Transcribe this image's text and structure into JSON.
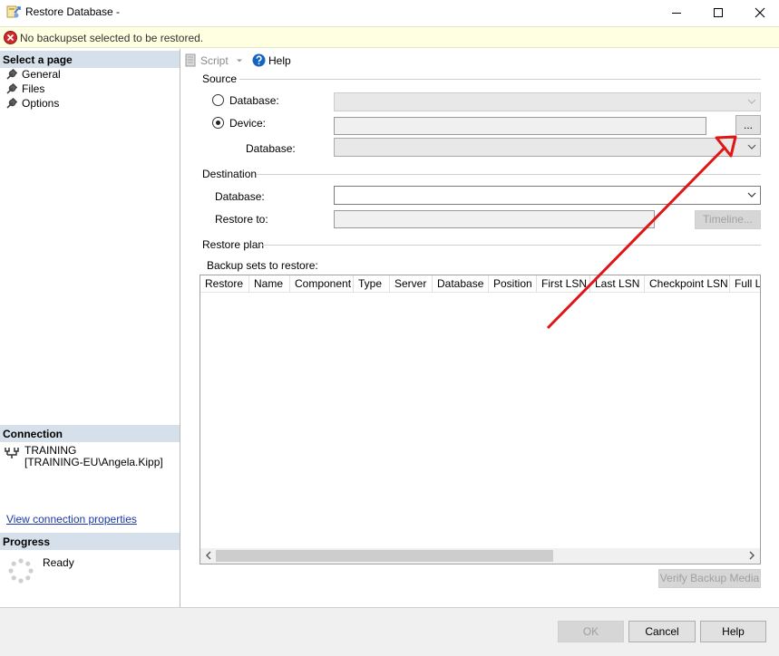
{
  "window": {
    "title": "Restore Database -"
  },
  "error_bar": {
    "message": "No backupset selected to be restored."
  },
  "left_panel": {
    "select_page_header": "Select a page",
    "pages": [
      "General",
      "Files",
      "Options"
    ],
    "connection_header": "Connection",
    "connection_server": "TRAINING",
    "connection_user": "[TRAINING-EU\\Angela.Kipp]",
    "connection_link": "View connection properties",
    "progress_header": "Progress",
    "progress_status": "Ready"
  },
  "toolbar": {
    "script_label": "Script",
    "help_label": "Help"
  },
  "source": {
    "section_label": "Source",
    "database_radio_label": "Database:",
    "device_radio_label": "Device:",
    "selected": "device",
    "device_database_label": "Database:",
    "browse_label": "..."
  },
  "destination": {
    "section_label": "Destination",
    "database_label": "Database:",
    "restore_to_label": "Restore to:",
    "timeline_label": "Timeline..."
  },
  "restore_plan": {
    "section_label": "Restore plan",
    "backup_sets_label": "Backup sets to restore:",
    "columns": [
      "Restore",
      "Name",
      "Component",
      "Type",
      "Server",
      "Database",
      "Position",
      "First LSN",
      "Last LSN",
      "Checkpoint LSN",
      "Full LSN"
    ],
    "verify_label": "Verify Backup Media"
  },
  "footer": {
    "ok_label": "OK",
    "cancel_label": "Cancel",
    "help_label": "Help"
  },
  "colors": {
    "error_bar_bg": "#ffffe1",
    "panel_header_bg": "#d6e0ea",
    "annotation_arrow": "#e01515",
    "link": "#1a37a8"
  }
}
